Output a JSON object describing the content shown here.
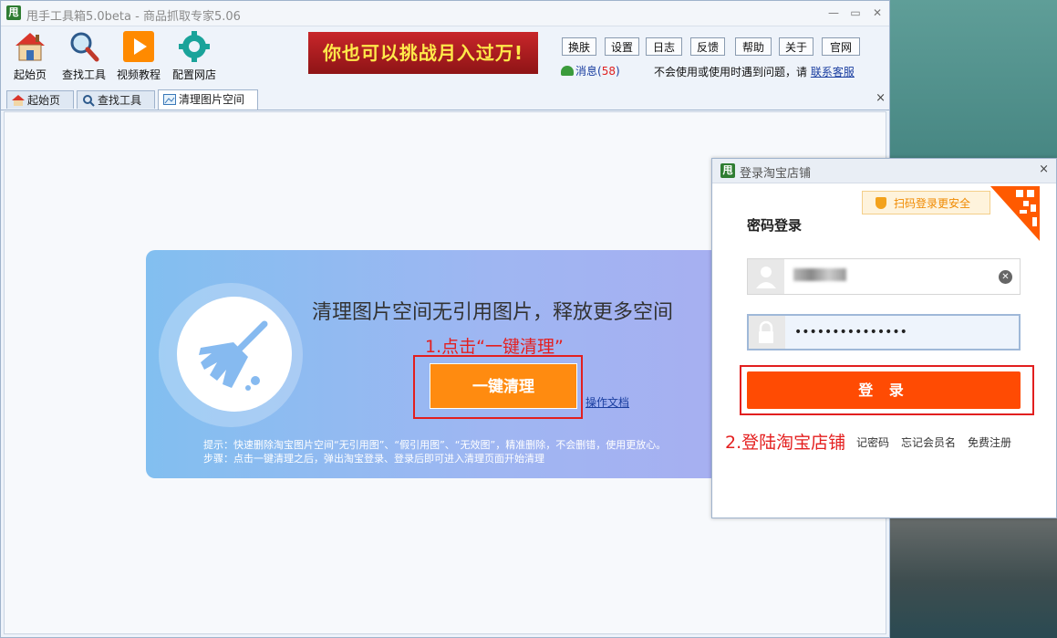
{
  "window": {
    "title": "甩手工具箱5.0beta - 商品抓取专家5.06",
    "app_icon": "甩",
    "controls": [
      "—",
      "▭",
      "✕"
    ]
  },
  "toolbar": {
    "tools": [
      {
        "label": "起始页",
        "icon": "home-icon"
      },
      {
        "label": "查找工具",
        "icon": "magnifier-icon"
      },
      {
        "label": "视频教程",
        "icon": "play-icon"
      },
      {
        "label": "配置网店",
        "icon": "gear-icon"
      }
    ],
    "banner": "你也可以挑战月入过万!",
    "top_buttons": [
      "换肤",
      "设置",
      "日志",
      "反馈",
      "帮助",
      "关于",
      "官网"
    ],
    "message_label": "消息(",
    "message_count": "58",
    "message_close": ")",
    "help_text": "不会使用或使用时遇到问题，请",
    "help_link": "联系客服"
  },
  "tabs": [
    {
      "label": "起始页",
      "icon": "home-icon",
      "active": false
    },
    {
      "label": "查找工具",
      "icon": "magnifier-icon",
      "active": false
    },
    {
      "label": "清理图片空间",
      "icon": "image-icon",
      "active": true
    }
  ],
  "tab_close": "×",
  "main": {
    "title": "清理图片空间无引用图片，释放更多空间",
    "step1": "1.点击“一键清理”",
    "clean_button": "一键清理",
    "doc_link": "操作文档",
    "tip_line1": "提示：快速删除淘宝图片空间“无引用图”、“假引用图”、“无效图”，精准删除，不会删错，使用更放心。",
    "tip_line2": "步骤：点击一键清理之后，弹出淘宝登录、登录后即可进入清理页面开始清理"
  },
  "dialog": {
    "title": "登录淘宝店铺",
    "close": "×",
    "qr_note": "扫码登录更安全",
    "password_title": "密码登录",
    "password_mask": "•••••••••••••••",
    "login_button": "登 录",
    "step2": "2.登陆淘宝店铺",
    "links": [
      "记密码",
      "忘记会员名",
      "免费注册"
    ]
  },
  "colors": {
    "accent_orange": "#ff8b10",
    "login_orange": "#ff4b03",
    "annotation_red": "#e21f1f",
    "banner_red": "#c8262a",
    "banner_text": "#ffe94a"
  }
}
